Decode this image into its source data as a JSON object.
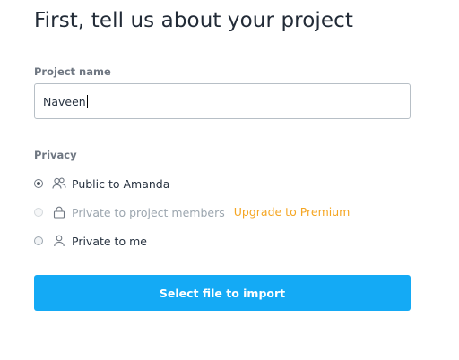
{
  "header": {
    "title": "First, tell us about your project"
  },
  "project_name": {
    "label": "Project name",
    "value": "Naveen"
  },
  "privacy": {
    "label": "Privacy",
    "options": [
      {
        "label": "Public to Amanda",
        "icon": "people-icon",
        "selected": true,
        "enabled": true
      },
      {
        "label": "Private to project members",
        "icon": "lock-icon",
        "selected": false,
        "enabled": false,
        "upgrade_label": "Upgrade to Premium"
      },
      {
        "label": "Private to me",
        "icon": "person-icon",
        "selected": false,
        "enabled": true
      }
    ]
  },
  "actions": {
    "import_label": "Select file to import"
  },
  "colors": {
    "primary": "#14aaf5",
    "upgrade": "#f5a623",
    "text": "#273240",
    "muted": "#6f7782"
  }
}
